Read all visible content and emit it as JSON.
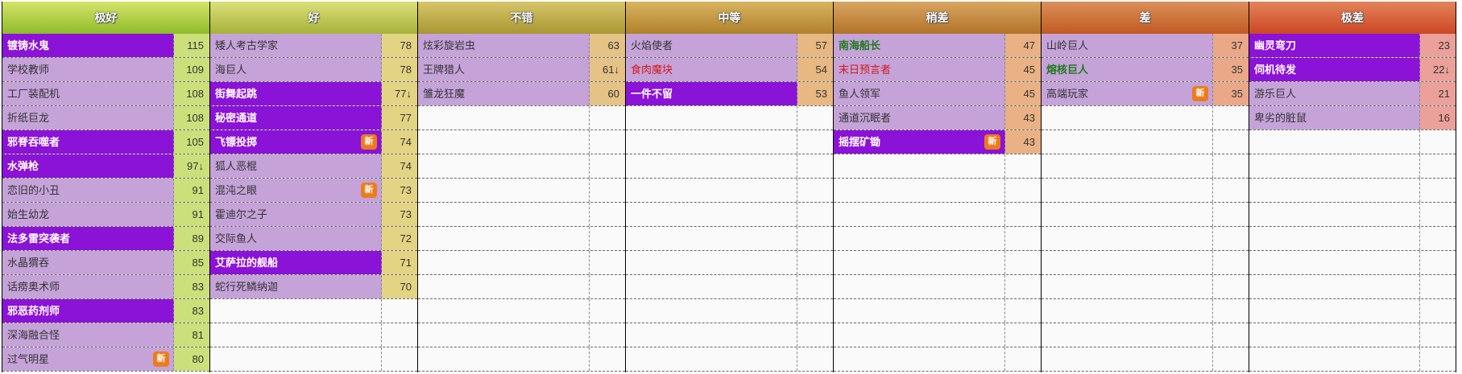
{
  "tiers": [
    {
      "label": "极好",
      "header_colors": [
        "#d5e46a",
        "#8fbb2a"
      ],
      "score_color": "#cbe07a",
      "entries": [
        {
          "name": "镀铸水鬼",
          "score": "115",
          "style": "bold",
          "new": false
        },
        {
          "name": "学校教师",
          "score": "109",
          "style": "normal",
          "new": false
        },
        {
          "name": "工厂装配机",
          "score": "108",
          "style": "normal",
          "new": false
        },
        {
          "name": "折纸巨龙",
          "score": "108",
          "style": "normal",
          "new": false
        },
        {
          "name": "邪脊吞噬者",
          "score": "105",
          "style": "bold",
          "new": false
        },
        {
          "name": "水弹枪",
          "score": "97↓",
          "style": "bold",
          "new": false
        },
        {
          "name": "恋旧的小丑",
          "score": "91",
          "style": "normal",
          "new": false
        },
        {
          "name": "始生幼龙",
          "score": "91",
          "style": "normal",
          "new": false
        },
        {
          "name": "法多雷突袭者",
          "score": "89",
          "style": "bold",
          "new": false
        },
        {
          "name": "水晶猬吞",
          "score": "85",
          "style": "normal",
          "new": false
        },
        {
          "name": "话痨奥术师",
          "score": "83",
          "style": "normal",
          "new": false
        },
        {
          "name": "邪恶药剂师",
          "score": "83",
          "style": "bold",
          "new": false
        },
        {
          "name": "深海融合怪",
          "score": "81",
          "style": "normal",
          "new": false
        },
        {
          "name": "过气明星",
          "score": "80",
          "style": "normal",
          "new": true
        }
      ]
    },
    {
      "label": "好",
      "header_colors": [
        "#dbe07a",
        "#a6b23a"
      ],
      "score_color": "#e3d483",
      "entries": [
        {
          "name": "矮人考古学家",
          "score": "78",
          "style": "normal",
          "new": false
        },
        {
          "name": "海巨人",
          "score": "78",
          "style": "normal",
          "new": false
        },
        {
          "name": "街舞起跳",
          "score": "77↓",
          "style": "bold",
          "new": false
        },
        {
          "name": "秘密通道",
          "score": "77",
          "style": "bold",
          "new": false
        },
        {
          "name": "飞镖投掷",
          "score": "74",
          "style": "bold",
          "new": true
        },
        {
          "name": "狐人恶棍",
          "score": "74",
          "style": "normal",
          "new": false
        },
        {
          "name": "混沌之眼",
          "score": "73",
          "style": "normal",
          "new": true
        },
        {
          "name": "霍迪尔之子",
          "score": "73",
          "style": "normal",
          "new": false
        },
        {
          "name": "交际鱼人",
          "score": "72",
          "style": "normal",
          "new": false
        },
        {
          "name": "艾萨拉的舰船",
          "score": "71",
          "style": "bold",
          "new": false
        },
        {
          "name": "蛇行死鳞纳迦",
          "score": "70",
          "style": "normal",
          "new": false
        }
      ]
    },
    {
      "label": "不错",
      "header_colors": [
        "#d7c66a",
        "#a99733"
      ],
      "score_color": "#e5c285",
      "entries": [
        {
          "name": "炫彩旋岩虫",
          "score": "63",
          "style": "normal",
          "new": false
        },
        {
          "name": "王牌猎人",
          "score": "61↓",
          "style": "normal",
          "new": false
        },
        {
          "name": "雏龙狂魔",
          "score": "60",
          "style": "normal",
          "new": false
        }
      ]
    },
    {
      "label": "中等",
      "header_colors": [
        "#d9b460",
        "#b0812b"
      ],
      "score_color": "#e7b882",
      "entries": [
        {
          "name": "火焰使者",
          "score": "57",
          "style": "normal",
          "new": false
        },
        {
          "name": "食肉魔块",
          "score": "54",
          "style": "red",
          "new": false
        },
        {
          "name": "一件不留",
          "score": "53",
          "style": "bold",
          "new": false
        }
      ]
    },
    {
      "label": "稍差",
      "header_colors": [
        "#d9a660",
        "#b27229"
      ],
      "score_color": "#e9b184",
      "entries": [
        {
          "name": "南海船长",
          "score": "47",
          "style": "gold",
          "new": false
        },
        {
          "name": "末日预言者",
          "score": "45",
          "style": "red",
          "new": false
        },
        {
          "name": "鱼人领军",
          "score": "45",
          "style": "normal",
          "new": false
        },
        {
          "name": "通道沉眠者",
          "score": "43",
          "style": "normal",
          "new": false
        },
        {
          "name": "摇摆矿锄",
          "score": "43",
          "style": "bold",
          "new": true
        }
      ]
    },
    {
      "label": "差",
      "header_colors": [
        "#dc8f59",
        "#c15a23"
      ],
      "score_color": "#eaa888",
      "entries": [
        {
          "name": "山岭巨人",
          "score": "37",
          "style": "normal",
          "new": false
        },
        {
          "name": "熔核巨人",
          "score": "35",
          "style": "gold",
          "new": false
        },
        {
          "name": "高端玩家",
          "score": "35",
          "style": "normal",
          "new": true
        }
      ]
    },
    {
      "label": "极差",
      "header_colors": [
        "#e3845a",
        "#cc4624"
      ],
      "score_color": "#eba09a",
      "entries": [
        {
          "name": "幽灵弯刀",
          "score": "23",
          "style": "bold",
          "new": false
        },
        {
          "name": "伺机待发",
          "score": "22↓",
          "style": "bold",
          "new": false
        },
        {
          "name": "游乐巨人",
          "score": "21",
          "style": "normal",
          "new": false
        },
        {
          "name": "卑劣的脏鼠",
          "score": "16",
          "style": "normal",
          "new": false
        }
      ]
    }
  ],
  "new_badge_label": "新",
  "total_rows": 14
}
